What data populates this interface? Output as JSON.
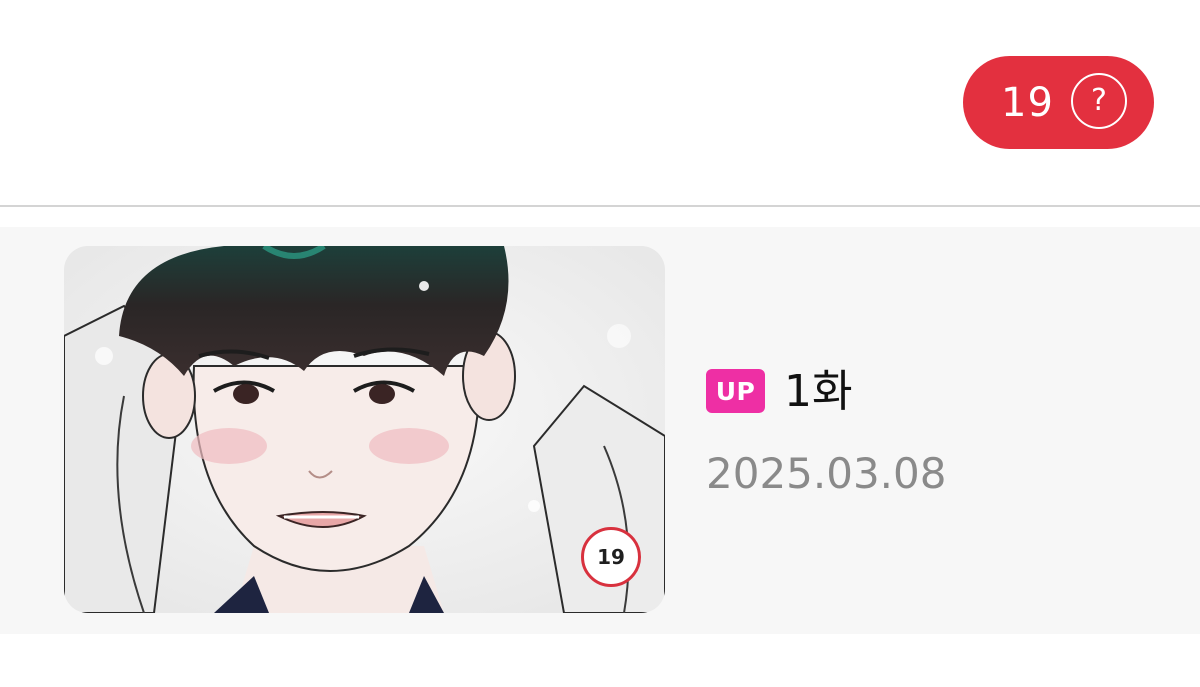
{
  "header": {
    "age_rating": "19",
    "help_symbol": "?"
  },
  "episode": {
    "badge": "UP",
    "title": "1화",
    "date": "2025.03.08",
    "thumbnail_age_rating": "19"
  },
  "colors": {
    "age_pill": "#e3303f",
    "up_badge": "#ee2fa4",
    "row_background": "#f7f7f7",
    "date_text": "#8a8a8a"
  },
  "icons": {
    "help": "question-circle-icon"
  }
}
